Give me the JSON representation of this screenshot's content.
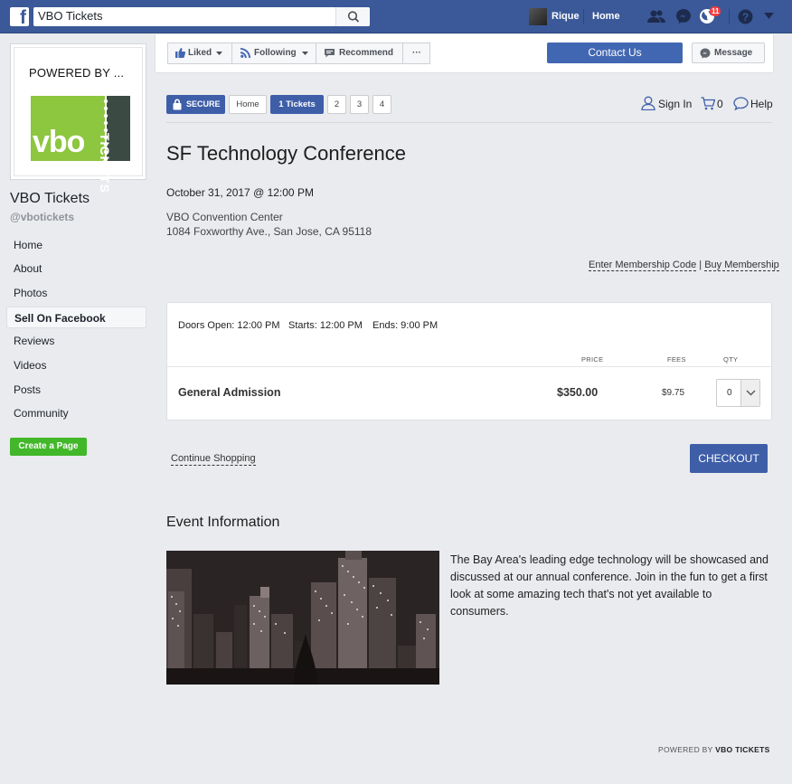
{
  "topbar": {
    "search_value": "VBO Tickets",
    "user_name": "Rique",
    "home_label": "Home",
    "notification_count": "11"
  },
  "sidebar": {
    "powered_by": "POWERED BY ...",
    "logo_text": "vbo",
    "logo_side_text": "TICKETS",
    "page_name": "VBO Tickets",
    "page_handle": "@vbotickets",
    "items": [
      {
        "label": "Home"
      },
      {
        "label": "About"
      },
      {
        "label": "Photos"
      },
      {
        "label": "Sell On Facebook"
      },
      {
        "label": "Reviews"
      },
      {
        "label": "Videos"
      },
      {
        "label": "Posts"
      },
      {
        "label": "Community"
      }
    ],
    "create_page": "Create a Page"
  },
  "actions": {
    "liked": "Liked",
    "following": "Following",
    "recommend": "Recommend",
    "more": "···",
    "contact": "Contact Us",
    "message": "Message"
  },
  "steps": {
    "secure": "SECURE",
    "home": "Home",
    "tickets": "1 Tickets",
    "s2": "2",
    "s3": "3",
    "s4": "4"
  },
  "util": {
    "sign_in": "Sign In",
    "cart_count": "0",
    "help": "Help"
  },
  "event": {
    "title": "SF Technology Conference",
    "date": "October 31, 2017 @ 12:00 PM",
    "venue_name": "VBO Convention Center",
    "venue_address": "1084 Foxworthy Ave., San Jose, CA 95118",
    "membership_code": "Enter Membership Code",
    "membership_sep": "|",
    "buy_membership": "Buy Membership"
  },
  "tickets": {
    "doors": "Doors Open: 12:00 PM",
    "starts": "Starts: 12:00 PM",
    "ends": "Ends: 9:00 PM",
    "col_price": "PRICE",
    "col_fees": "FEES",
    "col_qty": "QTY",
    "rows": [
      {
        "name": "General Admission",
        "price": "$350.00",
        "fee": "$9.75",
        "qty": "0"
      }
    ]
  },
  "bottom": {
    "continue_shopping": "Continue Shopping",
    "checkout": "CHECKOUT",
    "info_heading": "Event Information",
    "description": "The Bay Area's leading edge technology will be showcased and discussed at our annual conference. Join in the fun to get a first look at some amazing tech that's not yet available to consumers.",
    "footer_prefix": "POWERED BY",
    "footer_brand": "VBO TICKETS"
  },
  "colors": {
    "facebook_blue": "#3b5998",
    "button_blue": "#4267b2",
    "vbo_green": "#8dc63f",
    "create_green": "#42b72a"
  }
}
